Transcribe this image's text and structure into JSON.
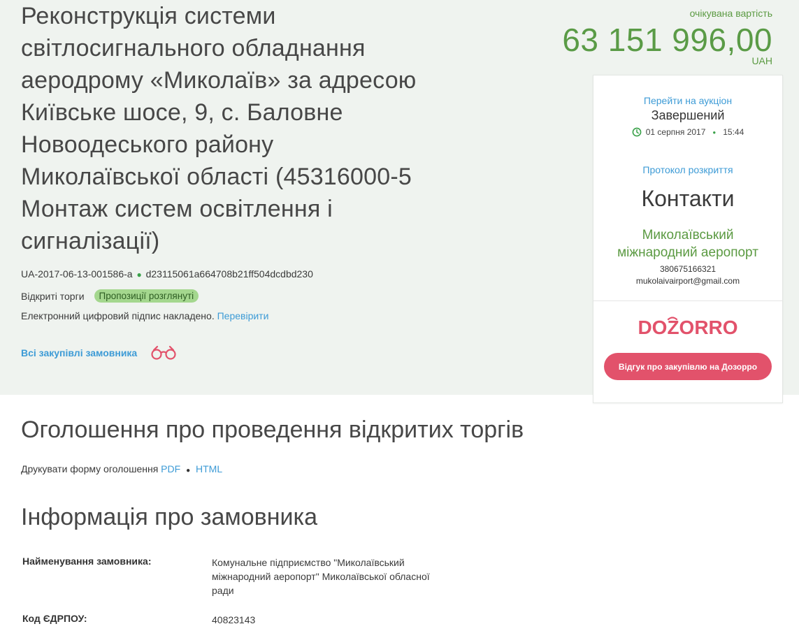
{
  "tender": {
    "title_lines": [
      "Реконструкція системи",
      "світлосигнального обладнання",
      "аеродрому «Миколаїв» за адресою",
      "Київське шосе, 9, с. Баловне",
      "Новоодеського району",
      "Миколаївської області (45316000-5",
      "Монтаж систем освітлення і",
      "сигналізації)"
    ],
    "id": "UA-2017-06-13-001586-a",
    "hash": "d23115061a664708b21ff504dcdbd230",
    "procedure": "Відкриті торги",
    "status_badge": "Пропозиції розглянуті",
    "signature_text": "Електронний цифровий підпис накладено.",
    "verify_link": "Перевірити",
    "all_purchases_link": "Всі закупівлі замовника"
  },
  "price": {
    "label": "очікувана вартість",
    "value": "63 151 996,00",
    "currency": "UAH"
  },
  "auction": {
    "go_link": "Перейти на аукціон",
    "status": "Завершений",
    "date": "01 серпня 2017",
    "time": "15:44",
    "protocol_link": "Протокол розкриття"
  },
  "contacts": {
    "title": "Контакти",
    "org_line1": "Миколаївський",
    "org_line2": "міжнародний аеропорт",
    "phone": "380675166321",
    "email": "mukolaivairport@gmail.com"
  },
  "dozorro": {
    "logo_text": "DOZORRO",
    "button_label": "Відгук про закупівлю на Дозорро"
  },
  "announcement": {
    "heading": "Оголошення про проведення відкритих торгів",
    "print_label": "Друкувати форму оголошення",
    "pdf_link": "PDF",
    "html_link": "HTML"
  },
  "customer_info": {
    "heading": "Інформація про замовника",
    "rows": [
      {
        "label": "Найменування замовника:",
        "value_lines": [
          "Комунальне підприємство \"Миколаївський",
          "міжнародний аеропорт\" Миколаївської обласної",
          "ради"
        ]
      },
      {
        "label": "Код ЄДРПОУ:",
        "value_lines": [
          "40823143"
        ]
      }
    ]
  },
  "colors": {
    "band_bg": "#eff3ef",
    "green_accent": "#5a9b46",
    "link_blue": "#3d9bd6",
    "dozorro_red": "#e2526b",
    "badge_green": "#a4d78e"
  },
  "icons": {
    "binoculars": "binoculars-icon",
    "clock": "clock-icon"
  }
}
